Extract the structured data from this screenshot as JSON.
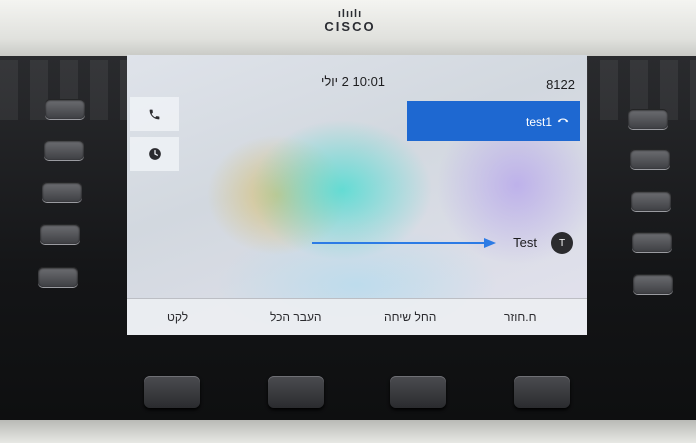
{
  "brand": {
    "bars": "ılıılı",
    "name": "CISCO"
  },
  "status": {
    "datetime": "10:01 2 יולי",
    "extension": "8122"
  },
  "side_buttons": [
    {
      "icon": "phone-icon"
    },
    {
      "icon": "clock-icon"
    }
  ],
  "line_key": {
    "label": "test1",
    "icon": "hangup-icon",
    "color": "#1e68d1"
  },
  "contact": {
    "name": "Test",
    "avatar_initial": "T"
  },
  "annotation": {
    "arrow_color": "#2c7be5"
  },
  "softkeys": [
    {
      "label": "לקט"
    },
    {
      "label": "העבר הכל"
    },
    {
      "label": "החל שיחה"
    },
    {
      "label": "ח.חוזר"
    }
  ]
}
